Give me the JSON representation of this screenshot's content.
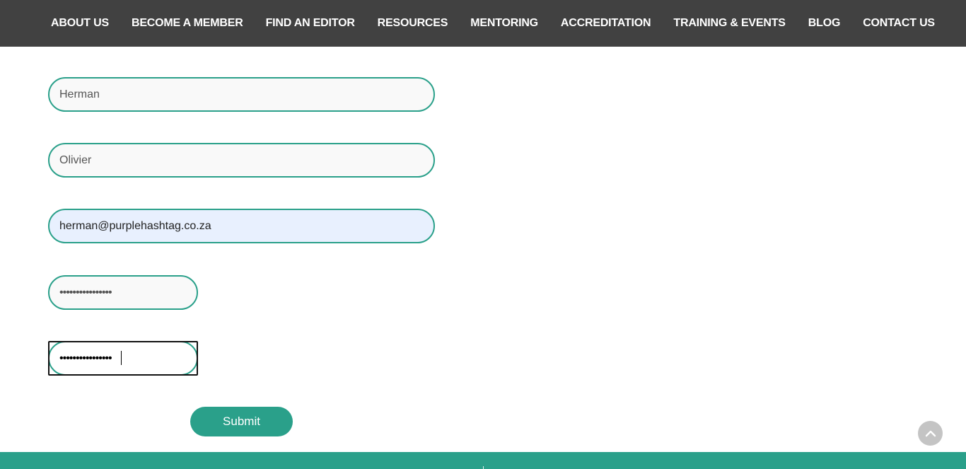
{
  "nav": {
    "items": [
      "ABOUT US",
      "BECOME A MEMBER",
      "FIND AN EDITOR",
      "RESOURCES",
      "MENTORING",
      "ACCREDITATION",
      "TRAINING & EVENTS",
      "BLOG",
      "CONTACT US"
    ]
  },
  "form": {
    "first_name": "Herman",
    "last_name": "Olivier",
    "email": "herman@purplehashtag.co.za",
    "password": "••••••••••••••••",
    "confirm_password": "••••••••••••••••",
    "submit_label": "Submit"
  },
  "colors": {
    "nav_bg": "#414141",
    "accent": "#2aa08a",
    "autofill_bg": "#e8f0fe",
    "scroll_top_bg": "#c4c4c4"
  },
  "icons": {
    "scroll_top": "chevron-up-icon"
  }
}
